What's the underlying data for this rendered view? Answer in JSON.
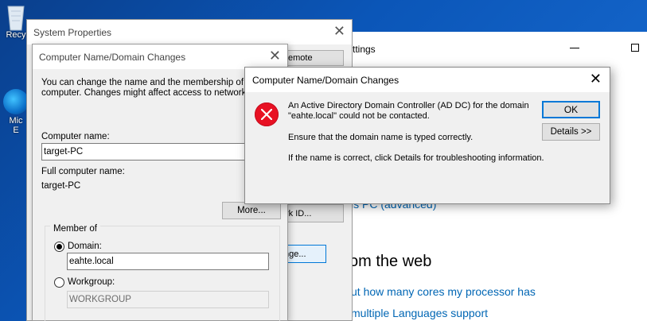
{
  "desktop": {
    "recycle_label": "Recy",
    "edge_label_1": "Mic",
    "edge_label_2": "E"
  },
  "settings": {
    "title": "ttings",
    "link_advanced": "is PC (advanced)",
    "section_title": "om the web",
    "link_cores": "ut how many cores my processor has",
    "link_languages": "multiple Languages support"
  },
  "system_properties": {
    "title": "System Properties",
    "remote_button": "emote",
    "network_button": "rk ID...",
    "change_button": "nge..."
  },
  "domain_dialog": {
    "title": "Computer Name/Domain Changes",
    "intro": "You can change the name and the membership of this computer. Changes might affect access to network res",
    "intro_line1": "You can change the name and the membership of this",
    "intro_line2": "computer. Changes might affect access to network res",
    "computer_name_label": "Computer name:",
    "computer_name_value": "target-PC",
    "full_name_label": "Full computer name:",
    "full_name_value": "target-PC",
    "more_button": "More...",
    "member_of_label": "Member of",
    "domain_label": "Domain:",
    "domain_value": "eahte.local",
    "workgroup_label": "Workgroup:",
    "workgroup_value": "WORKGROUP"
  },
  "error_dialog": {
    "title": "Computer Name/Domain Changes",
    "message_line1": "An Active Directory Domain Controller (AD DC) for the domain",
    "message_line2": "\"eahte.local\" could not be contacted.",
    "message_ensure": "Ensure that the domain name is typed correctly.",
    "message_details": "If the name is correct, click Details for troubleshooting information.",
    "ok_button": "OK",
    "details_button": "Details >>"
  }
}
